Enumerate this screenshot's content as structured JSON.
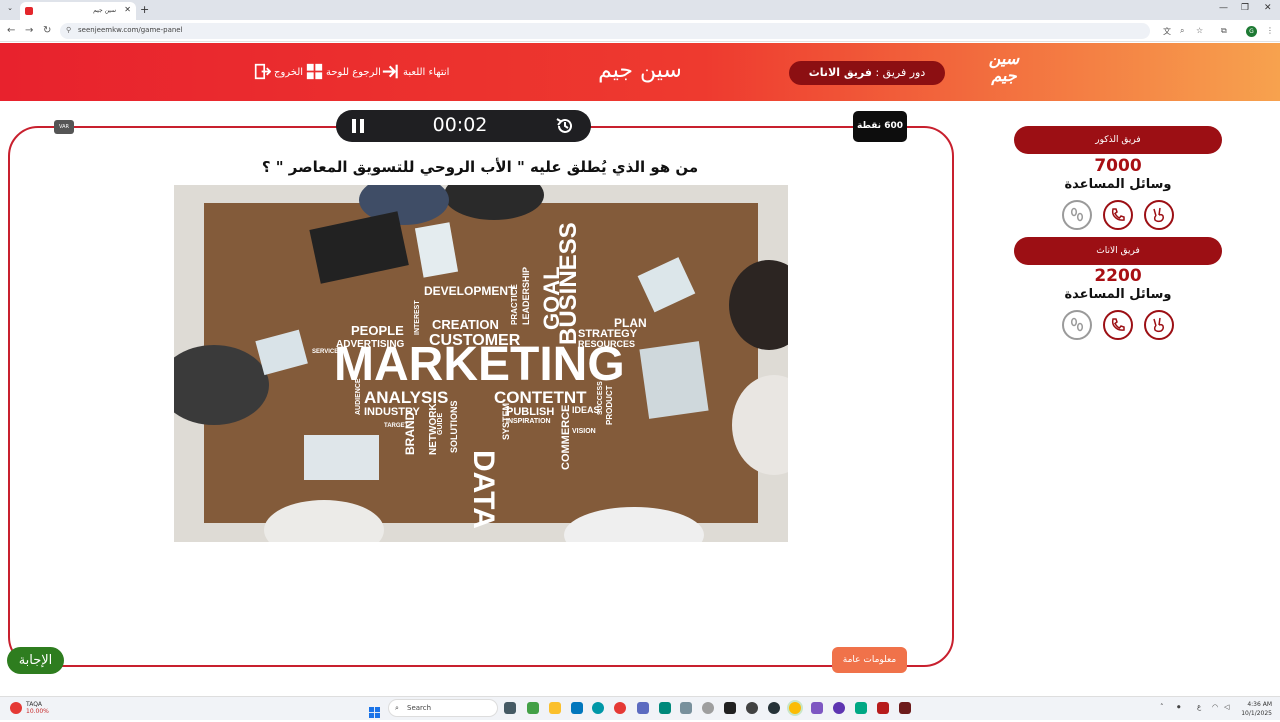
{
  "browser": {
    "tab_title": "سين جيم",
    "url": "seenjeemkw.com/game-panel"
  },
  "header": {
    "brand_title": "سين جيم",
    "logo_text": "سين جيم",
    "end_game_label": "انتهاء اللعبة",
    "back_to_board_label": "الرجوع للوحة",
    "exit_label": "الخروج",
    "turn_prefix": "دور فريق :",
    "turn_team": "فريق الاناث"
  },
  "game": {
    "timer": "00:02",
    "points": "600 نقطة",
    "var_badge": "VAR",
    "question": "من هو الذي يُطلق عليه \" الأب الروحي للتسويق المعاصر \" ؟",
    "answer_label": "الإجابة",
    "category_label": "معلومات عامة",
    "image_words": [
      "MARKETING",
      "DATA",
      "BUSINESS",
      "GOAL",
      "CUSTOMER",
      "CREATION",
      "DEVELOPMENT",
      "PEOPLE",
      "ADVERTISING",
      "ANALYSIS",
      "CONTETNT",
      "INDUSTRY",
      "PUBLISH",
      "STRATEGY",
      "RESOURCES",
      "PLAN",
      "COMMERCE",
      "BRAND",
      "NETWORK",
      "SOLUTIONS",
      "SYSTEM",
      "IDEAS",
      "LEADERSHIP",
      "PRACTICE",
      "INTEREST",
      "SERVICE",
      "AUDIENCE",
      "TARGET",
      "INSPIRATION",
      "GUIDE",
      "PRODUCT",
      "VISION",
      "SUCCESS"
    ]
  },
  "teams": [
    {
      "name": "فريق الذكور",
      "score": "7000",
      "aids_label": "وسائل المساعدة"
    },
    {
      "name": "فريق الاناث",
      "score": "2200",
      "aids_label": "وسائل المساعدة"
    }
  ],
  "taskbar": {
    "weather_name": "TAQA",
    "weather_value": "10.00%",
    "search_placeholder": "Search",
    "time": "4:36 AM",
    "date": "10/1/2025"
  },
  "colors": {
    "brand_red": "#e8222d",
    "dark_red": "#9c0f14",
    "answer_green": "#2e7d1f",
    "category_orange": "#f0724a"
  }
}
